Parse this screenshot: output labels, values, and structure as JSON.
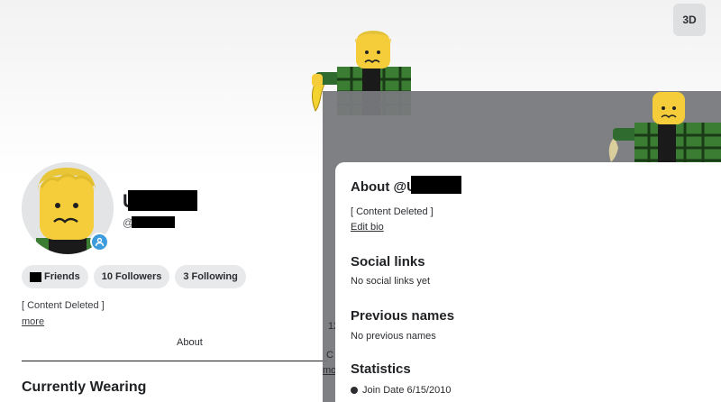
{
  "toolbar": {
    "view_3d_label": "3D"
  },
  "profile": {
    "display_name_visible": "U        n",
    "username_visible": "@U        n",
    "friends_label": "Friends",
    "followers_label": "10 Followers",
    "following_label": "3 Following",
    "bio": "[ Content Deleted ]",
    "more_label": "more"
  },
  "tabs": {
    "about_label": "About"
  },
  "sections": {
    "currently_wearing": "Currently Wearing"
  },
  "peek": {
    "count_fragment": "12",
    "c_fragment": "C",
    "mo_fragment": "mo"
  },
  "modal": {
    "title": "About @U        n",
    "bio": "[ Content Deleted ]",
    "edit_bio_label": "Edit bio",
    "social_links_title": "Social links",
    "social_links_empty": "No social links yet",
    "previous_names_title": "Previous names",
    "previous_names_empty": "No previous names",
    "statistics_title": "Statistics",
    "join_date": "Join Date 6/15/2010"
  }
}
